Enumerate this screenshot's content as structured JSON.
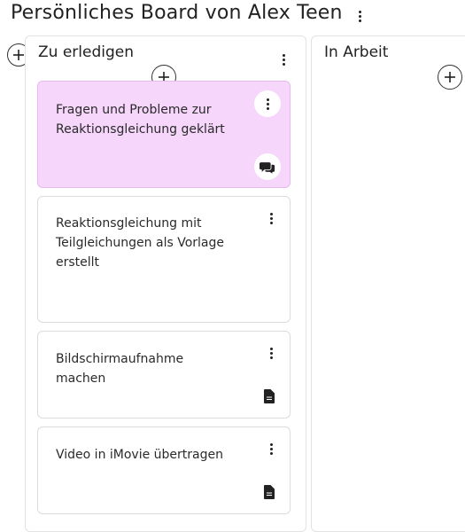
{
  "board": {
    "title": "Persönliches Board von Alex Teen"
  },
  "columns": [
    {
      "title": "Zu erledigen",
      "cards": [
        {
          "text": "Fragen und Probleme zur Reaktionsgleichung geklärt",
          "icon": "comments-icon",
          "highlight": true
        },
        {
          "text": "Reaktionsgleichung mit Teilgleichungen als Vorlage erstellt",
          "icon": null,
          "highlight": false
        },
        {
          "text": "Bildschirmaufnahme machen",
          "icon": "file-icon",
          "highlight": false
        },
        {
          "text": "Video in iMovie übertragen",
          "icon": "file-icon",
          "highlight": false
        }
      ]
    },
    {
      "title": "In Arbeit",
      "cards": []
    }
  ],
  "colors": {
    "highlight_card": "#f6d6fb",
    "highlight_border": "#e9b8f0",
    "icon": "#222222"
  }
}
